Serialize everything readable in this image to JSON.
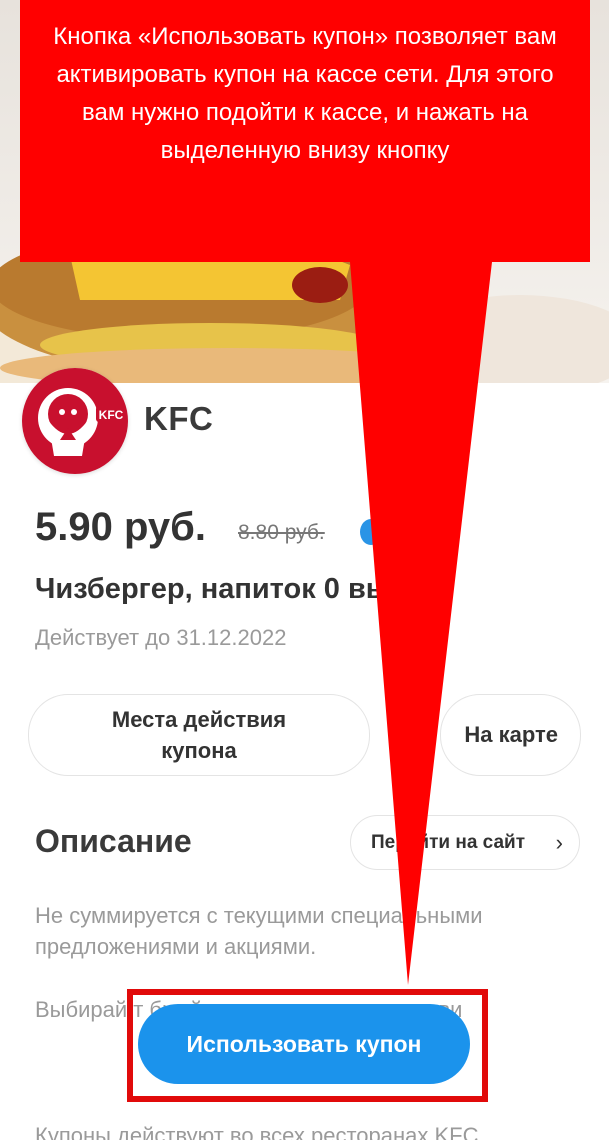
{
  "callout": {
    "text": "Кнопка «Использовать купон» позволяет вам активировать купон на кассе сети. Для этого вам нужно подойти к кассе, и нажать на выделенную внизу кнопку"
  },
  "brand": {
    "name": "KFC",
    "logo_text": "KFC"
  },
  "coupon": {
    "price": "5.90 руб.",
    "old_price": "8.80 руб.",
    "title": "Чизбергер, напиток 0    выбор",
    "valid_until": "Действует до 31.12.2022"
  },
  "buttons": {
    "places": "Места действия купона",
    "map": "На карте",
    "site": "Перейти на сайт",
    "use_coupon": "Использовать купон"
  },
  "description": {
    "heading": "Описание",
    "paragraph1": "Не суммируется с текущими специальными предложениями и акциями.",
    "paragraph2": "Выбирай т                           бный номер к                                ск или предъяви",
    "paragraph3": "Купоны действуют во всех ресторанах KFC"
  },
  "colors": {
    "accent_blue": "#1b93ec",
    "callout_red": "#ff0000",
    "highlight_red": "#e10a0a",
    "kfc_red": "#c8102e"
  }
}
